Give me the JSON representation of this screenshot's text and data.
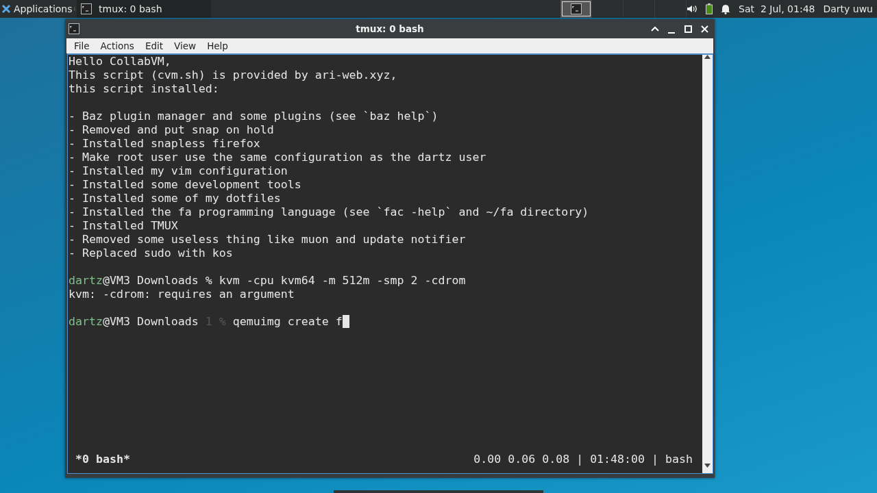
{
  "panel": {
    "apps_label": "Applications",
    "tasks": [
      {
        "title": "tmux: 0 bash",
        "selected": false
      }
    ],
    "workspaces": [
      {
        "selected": true,
        "has_window": true
      },
      {
        "selected": false,
        "has_window": false
      },
      {
        "selected": false,
        "has_window": false
      },
      {
        "selected": false,
        "has_window": false
      }
    ],
    "clock": "Sat  2 Jul, 01:48",
    "user": "Darty uwu"
  },
  "window": {
    "title": "tmux: 0 bash",
    "menu": [
      "File",
      "Actions",
      "Edit",
      "View",
      "Help"
    ]
  },
  "terminal": {
    "lines": [
      {
        "kind": "text",
        "segments": [
          {
            "kind": "plain",
            "text": "Hello CollabVM,"
          }
        ]
      },
      {
        "kind": "text",
        "segments": [
          {
            "kind": "plain",
            "text": "This script (cvm.sh) is provided by ari-web.xyz,"
          }
        ]
      },
      {
        "kind": "text",
        "segments": [
          {
            "kind": "plain",
            "text": "this script installed:"
          }
        ]
      },
      {
        "kind": "blank"
      },
      {
        "kind": "text",
        "segments": [
          {
            "kind": "plain",
            "text": "- Baz plugin manager and some plugins (see `baz help`)"
          }
        ]
      },
      {
        "kind": "text",
        "segments": [
          {
            "kind": "plain",
            "text": "- Removed and put snap on hold"
          }
        ]
      },
      {
        "kind": "text",
        "segments": [
          {
            "kind": "plain",
            "text": "- Installed snapless firefox"
          }
        ]
      },
      {
        "kind": "text",
        "segments": [
          {
            "kind": "plain",
            "text": "- Make root user use the same configuration as the dartz user"
          }
        ]
      },
      {
        "kind": "text",
        "segments": [
          {
            "kind": "plain",
            "text": "- Installed my vim configuration"
          }
        ]
      },
      {
        "kind": "text",
        "segments": [
          {
            "kind": "plain",
            "text": "- Installed some development tools"
          }
        ]
      },
      {
        "kind": "text",
        "segments": [
          {
            "kind": "plain",
            "text": "- Installed some of my dotfiles"
          }
        ]
      },
      {
        "kind": "text",
        "segments": [
          {
            "kind": "plain",
            "text": "- Installed the fa programming language (see `fac -help` and ~/fa directory)"
          }
        ]
      },
      {
        "kind": "text",
        "segments": [
          {
            "kind": "plain",
            "text": "- Installed TMUX"
          }
        ]
      },
      {
        "kind": "text",
        "segments": [
          {
            "kind": "plain",
            "text": "- Removed some useless thing like muon and update notifier"
          }
        ]
      },
      {
        "kind": "text",
        "segments": [
          {
            "kind": "plain",
            "text": "- Replaced sudo with kos"
          }
        ]
      },
      {
        "kind": "blank"
      },
      {
        "kind": "text",
        "segments": [
          {
            "kind": "user",
            "text": "dartz"
          },
          {
            "kind": "plain",
            "text": "@VM3 Downloads % kvm -cpu kvm64 -m 512m -smp 2 -cdrom"
          }
        ]
      },
      {
        "kind": "text",
        "segments": [
          {
            "kind": "plain",
            "text": "kvm: -cdrom: requires an argument"
          }
        ]
      },
      {
        "kind": "blank"
      },
      {
        "kind": "text",
        "segments": [
          {
            "kind": "user",
            "text": "dartz"
          },
          {
            "kind": "plain",
            "text": "@VM3 Downloads "
          },
          {
            "kind": "dim",
            "text": "1 %"
          },
          {
            "kind": "plain",
            "text": " qemuimg create f"
          },
          {
            "kind": "cursor"
          }
        ]
      }
    ],
    "status_left": "*0 bash*",
    "status_right": "0.00 0.06 0.08 | 01:48:00 | bash"
  }
}
